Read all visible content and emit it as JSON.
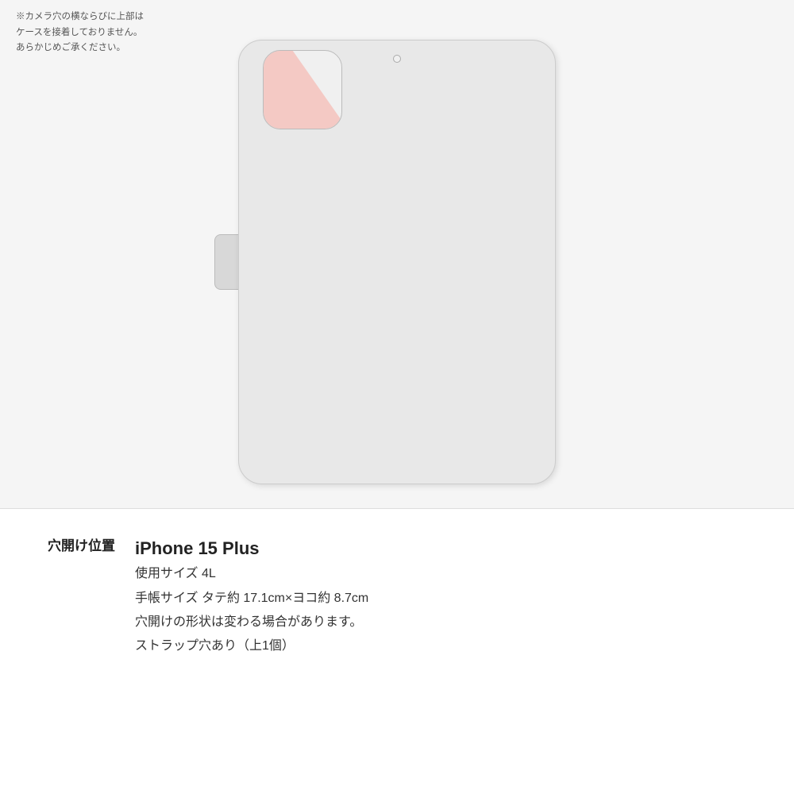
{
  "caseImage": {
    "altText": "iPhone 15 Plus手帳型ケース背面"
  },
  "noteText": {
    "line1": "※カメラ穴の横ならびに上部は",
    "line2": "ケースを接着しておりません。",
    "line3": "あらかじめご承ください。"
  },
  "infoSection": {
    "label": "穴開け位置",
    "model": "iPhone 15 Plus",
    "details": [
      "使用サイズ 4L",
      "手帳サイズ タテ約 17.1cm×ヨコ約 8.7cm",
      "穴開けの形状は変わる場合があります。",
      "ストラップ穴あり（上1個）"
    ]
  }
}
